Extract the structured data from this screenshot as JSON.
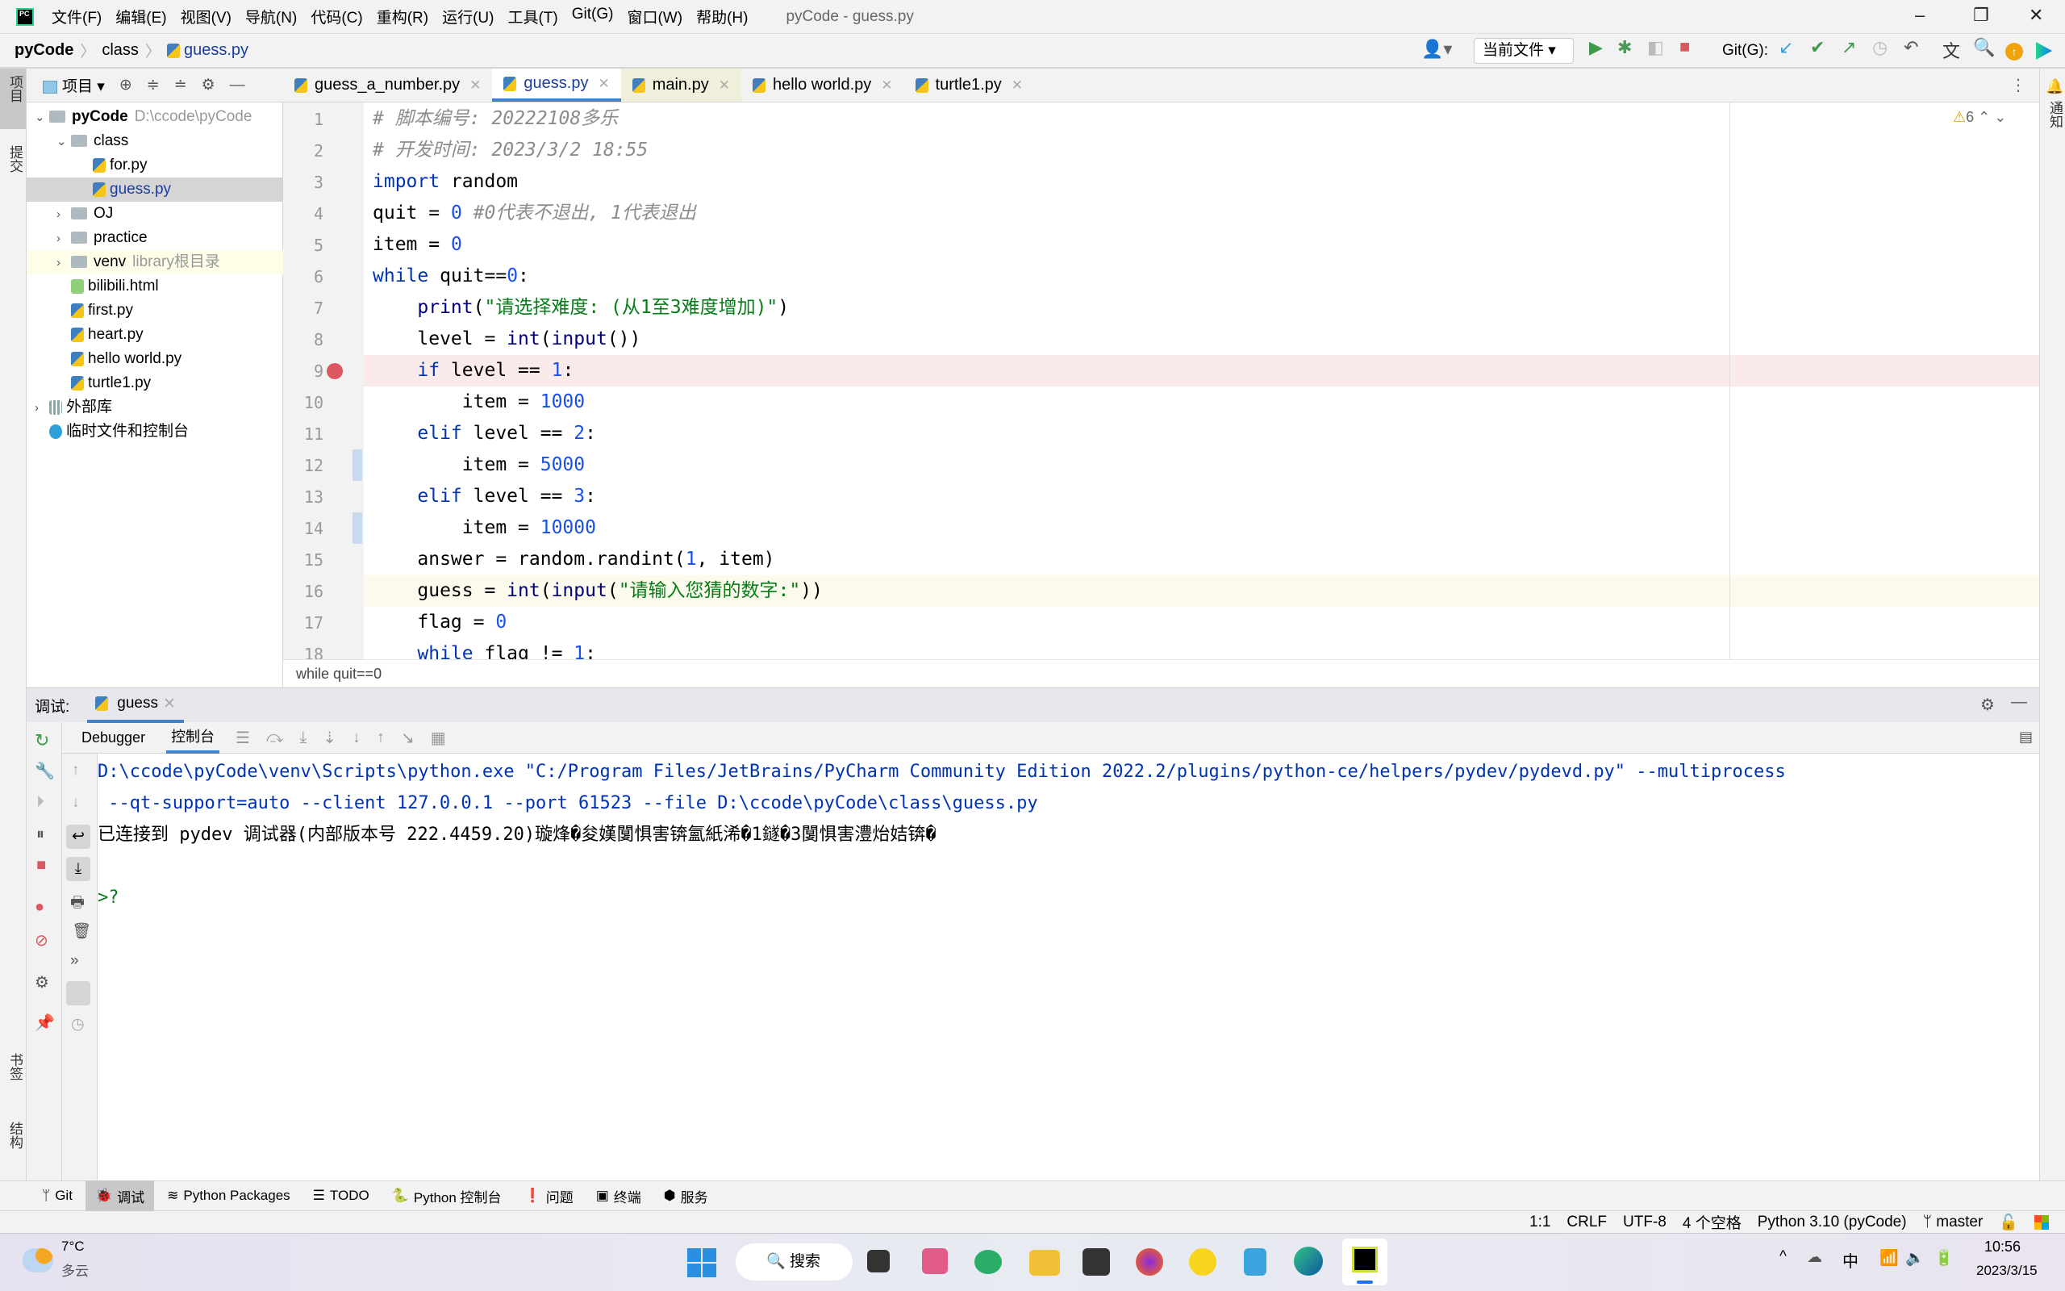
{
  "window": {
    "title": "pyCode - guess.py",
    "menu": [
      "文件(F)",
      "编辑(E)",
      "视图(V)",
      "导航(N)",
      "代码(C)",
      "重构(R)",
      "运行(U)",
      "工具(T)",
      "Git(G)",
      "窗口(W)",
      "帮助(H)"
    ]
  },
  "breadcrumb": [
    "pyCode",
    "class",
    "guess.py"
  ],
  "toolbar": {
    "run_config": "当前文件",
    "git_label": "Git(G):"
  },
  "left_strip": {
    "project": "项目",
    "commit": "提交",
    "bookmarks": "书签",
    "structure": "结构"
  },
  "right_strip": {
    "notifications": "通知"
  },
  "project": {
    "header": "项目",
    "tree": [
      {
        "label": "pyCode",
        "hint": "D:\\ccode\\pyCode",
        "type": "folder",
        "depth": 0,
        "arrow": "v",
        "bold": true
      },
      {
        "label": "class",
        "type": "folder",
        "depth": 1,
        "arrow": "v"
      },
      {
        "label": "for.py",
        "type": "py",
        "depth": 2
      },
      {
        "label": "guess.py",
        "type": "py",
        "depth": 2,
        "selected": true
      },
      {
        "label": "OJ",
        "type": "folder",
        "depth": 1,
        "arrow": ">"
      },
      {
        "label": "practice",
        "type": "folder",
        "depth": 1,
        "arrow": ">"
      },
      {
        "label": "venv",
        "hint": "library根目录",
        "type": "folder",
        "depth": 1,
        "arrow": ">",
        "lib": true
      },
      {
        "label": "bilibili.html",
        "type": "html",
        "depth": 1
      },
      {
        "label": "first.py",
        "type": "py",
        "depth": 1
      },
      {
        "label": "heart.py",
        "type": "py",
        "depth": 1
      },
      {
        "label": "hello world.py",
        "type": "py",
        "depth": 1
      },
      {
        "label": "turtle1.py",
        "type": "py",
        "depth": 1
      },
      {
        "label": "外部库",
        "type": "lib",
        "depth": 0,
        "arrow": ">"
      },
      {
        "label": "临时文件和控制台",
        "type": "scratch",
        "depth": 0
      }
    ]
  },
  "tabs": [
    {
      "label": "guess_a_number.py"
    },
    {
      "label": "guess.py",
      "active": true
    },
    {
      "label": "main.py",
      "modified": true
    },
    {
      "label": "hello world.py"
    },
    {
      "label": "turtle1.py"
    }
  ],
  "editor": {
    "warnings": "6",
    "breakpoint_line": 9,
    "current_line": 16,
    "lines": [
      [
        [
          "# 脚本编号: 20222108多乐",
          "cmt"
        ]
      ],
      [
        [
          "# 开发时间: 2023/3/2 18:55",
          "cmt"
        ]
      ],
      [
        [
          "import",
          "kw"
        ],
        [
          " random",
          ""
        ]
      ],
      [
        [
          "quit = ",
          ""
        ],
        [
          "0",
          "num"
        ],
        [
          " #0代表不退出, 1代表退出",
          "cmt"
        ]
      ],
      [
        [
          "item = ",
          ""
        ],
        [
          "0",
          "num"
        ]
      ],
      [
        [
          "while",
          "kw"
        ],
        [
          " quit==",
          ""
        ],
        [
          "0",
          "num"
        ],
        [
          ":",
          ""
        ]
      ],
      [
        [
          "    ",
          ""
        ],
        [
          "print",
          "bi"
        ],
        [
          "(",
          ""
        ],
        [
          "\"请选择难度: (从1至3难度增加)\"",
          "str"
        ],
        [
          ")",
          ""
        ]
      ],
      [
        [
          "    level = ",
          ""
        ],
        [
          "int",
          "bi"
        ],
        [
          "(",
          ""
        ],
        [
          "input",
          "bi"
        ],
        [
          "())",
          ""
        ]
      ],
      [
        [
          "    ",
          ""
        ],
        [
          "if",
          "kw"
        ],
        [
          " level == ",
          ""
        ],
        [
          "1",
          "num"
        ],
        [
          ":",
          ""
        ]
      ],
      [
        [
          "        item = ",
          ""
        ],
        [
          "1000",
          "num"
        ]
      ],
      [
        [
          "    ",
          ""
        ],
        [
          "elif",
          "kw"
        ],
        [
          " level == ",
          ""
        ],
        [
          "2",
          "num"
        ],
        [
          ":",
          ""
        ]
      ],
      [
        [
          "        item = ",
          ""
        ],
        [
          "5000",
          "num"
        ]
      ],
      [
        [
          "    ",
          ""
        ],
        [
          "elif",
          "kw"
        ],
        [
          " level == ",
          ""
        ],
        [
          "3",
          "num"
        ],
        [
          ":",
          ""
        ]
      ],
      [
        [
          "        item = ",
          ""
        ],
        [
          "10000",
          "num"
        ]
      ],
      [
        [
          "    answer = random.randint(",
          ""
        ],
        [
          "1",
          "num"
        ],
        [
          ", item)",
          ""
        ]
      ],
      [
        [
          "    guess = ",
          ""
        ],
        [
          "int",
          "bi"
        ],
        [
          "(",
          ""
        ],
        [
          "input",
          "bi"
        ],
        [
          "(",
          ""
        ],
        [
          "\"请输入您猜的数字:\"",
          "str"
        ],
        [
          "))",
          ""
        ]
      ],
      [
        [
          "    flag = ",
          ""
        ],
        [
          "0",
          "num"
        ]
      ],
      [
        [
          "    ",
          ""
        ],
        [
          "while",
          "kw"
        ],
        [
          " flag != ",
          ""
        ],
        [
          "1",
          "num"
        ],
        [
          ":",
          ""
        ]
      ]
    ],
    "breadcrumb": "while quit==0"
  },
  "debug": {
    "label": "调试:",
    "session": "guess",
    "subtabs": [
      "Debugger",
      "控制台"
    ],
    "console": [
      {
        "text": "D:\\ccode\\pyCode\\venv\\Scripts\\python.exe \"C:/Program Files/JetBrains/PyCharm Community Edition 2022.2/plugins/python-ce/helpers/pydev/pydevd.py\" --multiprocess",
        "color": "#0033b3"
      },
      {
        "text": " --qt-support=auto --client 127.0.0.1 --port 61523 --file D:\\ccode\\pyCode\\class\\guess.py",
        "color": "#0033b3"
      },
      {
        "text": "已连接到 pydev 调试器(内部版本号 222.4459.20)璇烽�夋嫨闅惧害锛氳紙浠�1鐩�3闅惧害澧炲姞锛�",
        "color": "#000000"
      },
      {
        "text": "",
        "color": "#000000"
      },
      {
        "text": ">?",
        "color": "#067d17"
      }
    ]
  },
  "bottom_tools": [
    "Git",
    "调试",
    "Python Packages",
    "TODO",
    "Python 控制台",
    "问题",
    "终端",
    "服务"
  ],
  "status": [
    "1:1",
    "CRLF",
    "UTF-8",
    "4 个空格",
    "Python 3.10 (pyCode)",
    "master"
  ],
  "taskbar": {
    "weather_temp": "7°C",
    "weather_desc": "多云",
    "search": "搜索",
    "ime": "中",
    "time": "10:56",
    "date": "2023/3/15"
  },
  "colors": {
    "accent": "#4083c9",
    "keyword": "#0033b3",
    "number": "#1750eb",
    "string": "#067d17",
    "breakpoint_bg": "#faeae9",
    "breakpoint": "#db5860"
  }
}
